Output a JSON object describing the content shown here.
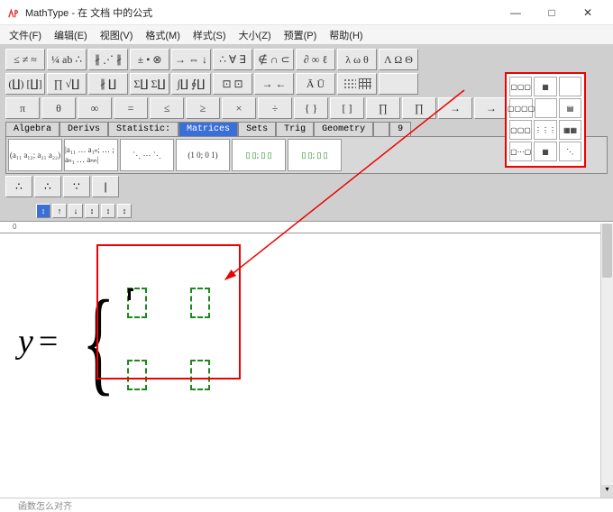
{
  "window": {
    "title": "MathType - 在 文档 中的公式"
  },
  "menus": {
    "file": "文件(F)",
    "edit": "编辑(E)",
    "view": "视图(V)",
    "format": "格式(M)",
    "style": "样式(S)",
    "size": "大小(Z)",
    "preset": "预置(P)",
    "help": "帮助(H)"
  },
  "palette_row1": [
    "≤ ≠ ≈",
    "¼ ab ∴",
    "∦ ⋰ ∦",
    "± • ⊗",
    "→ ⇔ ↓",
    "∴ ∀ ∃",
    "∉ ∩ ⊂",
    "∂ ∞ ℓ",
    "λ ω θ",
    "Λ Ω Θ"
  ],
  "palette_row2": [
    "(∐) [∐]",
    "∏ √∐",
    "∦ ∐",
    "Σ∐ Σ∐",
    "∫∐ ∮∐",
    "⊡ ⊡",
    "→ ←",
    "Ā Ū",
    "▢▢▢",
    ""
  ],
  "palette_row3": [
    "π",
    "θ",
    "∞",
    "=",
    "≤",
    "≥",
    "×",
    "÷",
    "{ }",
    "[ ]",
    "∏",
    "∏",
    "→",
    "→",
    "→"
  ],
  "tabs": [
    "Algebra",
    "Derivs",
    "Statistic:",
    "Matrices",
    "Sets",
    "Trig",
    "Geometry",
    "",
    "9"
  ],
  "tabs_active_index": 3,
  "templates": [
    "(a₁₁ a₁₂; a₂₁ a₂₂)",
    "|a₁₁ … a₁ₙ; … ; aₙ₁ … aₙₙ|",
    "⋱ ⋯ ⋱",
    "(1 0; 0 1)",
    "▯ ▯; ▯ ▯",
    "▯ ▯; ▯ ▯"
  ],
  "templates2": [
    "∴",
    "∴",
    "∵",
    "|"
  ],
  "smalltools": [
    "↕",
    "↑",
    "↓",
    "↕",
    "↕",
    "↕"
  ],
  "equation": {
    "lhs": "y",
    "eq": "="
  },
  "ruler": {
    "origin": "0"
  },
  "bottom_text": "函数怎么对齐",
  "popup_cells": [
    [
      "▢▢▢",
      "▦",
      ""
    ],
    [
      "▢▢▢▢",
      "",
      "▤"
    ],
    [
      "▢▢▢",
      "⋮⋮⋮",
      "▦▦"
    ],
    [
      "▢⋯▢",
      "▦",
      "⋱"
    ]
  ]
}
